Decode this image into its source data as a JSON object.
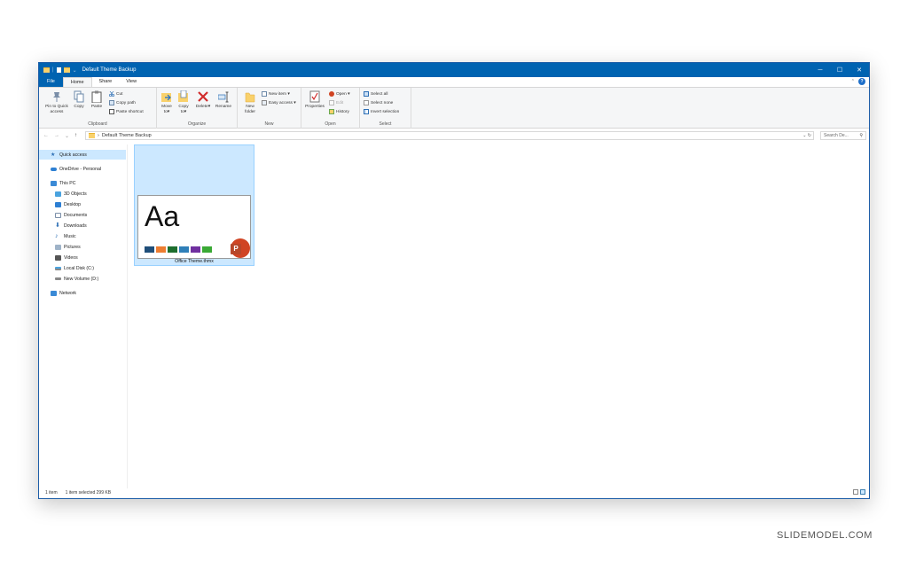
{
  "window": {
    "title": "Default Theme Backup",
    "controls": {
      "minimize": "─",
      "maximize": "☐",
      "close": "✕"
    }
  },
  "tabs": [
    {
      "label": "File"
    },
    {
      "label": "Home"
    },
    {
      "label": "Share"
    },
    {
      "label": "View"
    }
  ],
  "ribbon": {
    "clipboard": {
      "label": "Clipboard",
      "pin": "Pin to Quick access",
      "copy": "Copy",
      "paste": "Paste",
      "cut": "Cut",
      "copy_path": "Copy path",
      "paste_shortcut": "Paste shortcut"
    },
    "organize": {
      "label": "Organize",
      "move_to": "Move to▾",
      "copy_to": "Copy to▾",
      "delete": "Delete▾",
      "rename": "Rename"
    },
    "new": {
      "label": "New",
      "new_folder": "New folder",
      "new_item": "New item ▾",
      "easy_access": "Easy access ▾"
    },
    "open": {
      "label": "Open",
      "properties": "Properties",
      "open": "Open ▾",
      "edit": "Edit",
      "history": "History"
    },
    "select": {
      "label": "Select",
      "select_all": "Select all",
      "select_none": "Select none",
      "invert_selection": "Invert selection"
    }
  },
  "address": {
    "path": "Default Theme Backup",
    "search_placeholder": "Search De..."
  },
  "nav": {
    "items": [
      {
        "label": "Quick access"
      },
      {
        "label": "OneDrive - Personal"
      },
      {
        "label": "This PC"
      },
      {
        "label": "3D Objects"
      },
      {
        "label": "Desktop"
      },
      {
        "label": "Documents"
      },
      {
        "label": "Downloads"
      },
      {
        "label": "Music"
      },
      {
        "label": "Pictures"
      },
      {
        "label": "Videos"
      },
      {
        "label": "Local Disk (C:)"
      },
      {
        "label": "New Volume (D:)"
      },
      {
        "label": "Network"
      }
    ]
  },
  "files": [
    {
      "name": "Office Theme.thmx",
      "preview_text": "Aa",
      "swatches": [
        "#1f4e79",
        "#ed7d31",
        "#1e6e2e",
        "#2f7fb8",
        "#7030a0",
        "#3aa935"
      ]
    }
  ],
  "status": {
    "count": "1 item",
    "selected": "1 item selected  299 KB"
  },
  "watermark": "SLIDEMODEL.COM"
}
